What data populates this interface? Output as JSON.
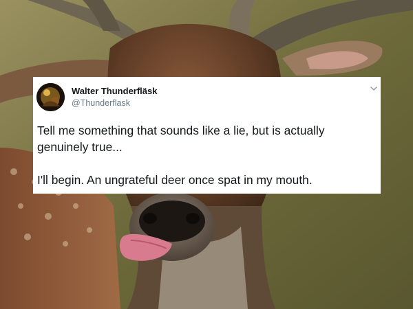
{
  "tweet": {
    "display_name": "Walter Thunderfläsk",
    "handle": "@Thunderflask",
    "lines": [
      "Tell me something that sounds like a lie, but is actually genuinely true...",
      "I'll begin. An ungrateful deer once spat in my mouth."
    ],
    "menu_icon": "chevron-down-icon"
  },
  "background": {
    "subject": "deer-photo"
  },
  "colors": {
    "card_bg": "#ffffff",
    "name_text": "#14171a",
    "handle_text": "#657786",
    "chevron": "#8899a6"
  }
}
